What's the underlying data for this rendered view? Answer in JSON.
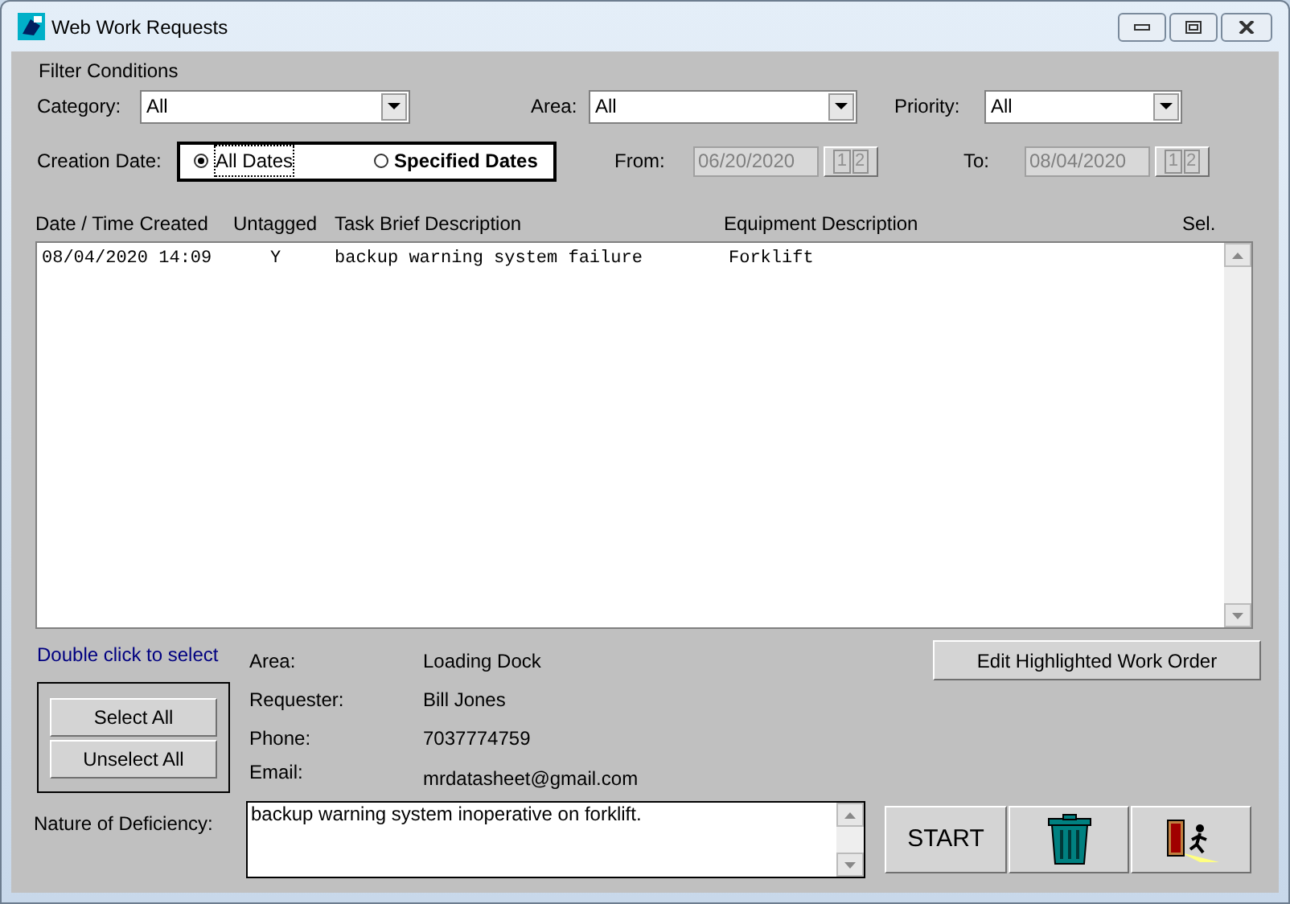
{
  "window": {
    "title": "Web Work Requests"
  },
  "filter": {
    "heading": "Filter Conditions",
    "dropdowns": [
      {
        "label": "Category:",
        "value": "All"
      },
      {
        "label": "Area:",
        "value": "All"
      },
      {
        "label": "Priority:",
        "value": "All"
      }
    ],
    "creation_date": {
      "label": "Creation Date:",
      "options": [
        {
          "label": "All Dates",
          "selected": true
        },
        {
          "label": "Specified Dates",
          "selected": false
        }
      ]
    },
    "from": {
      "label": "From:",
      "value": "06/20/2020",
      "picker": [
        "1",
        "2"
      ],
      "disabled": true
    },
    "to": {
      "label": "To:",
      "value": "08/04/2020",
      "picker": [
        "1",
        "2"
      ],
      "disabled": true
    }
  },
  "table": {
    "columns": [
      "Date / Time Created",
      "Untagged",
      "Task Brief Description",
      "Equipment Description",
      "Sel."
    ],
    "rows": [
      [
        "08/04/2020 14:09",
        "Y",
        "backup warning system failure",
        "Forklift"
      ]
    ]
  },
  "hint": "Double click to select",
  "select_buttons": [
    "Select All",
    "Unselect All"
  ],
  "details": [
    {
      "label": "Area:",
      "value": "Loading Dock"
    },
    {
      "label": "Requester:",
      "value": "Bill Jones"
    },
    {
      "label": "Phone:",
      "value": "7037774759"
    },
    {
      "label": "Email:",
      "value": "mrdatasheet@gmail.com"
    }
  ],
  "edit_button": "Edit Highlighted Work Order",
  "deficiency": {
    "label": "Nature of Deficiency:",
    "value": "backup warning system inoperative on forklift."
  },
  "start_button": "START"
}
